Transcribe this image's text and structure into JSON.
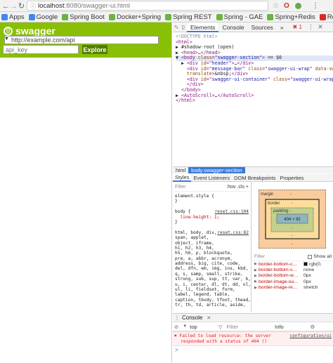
{
  "browser": {
    "url_host": "localhost",
    "url_path": ":8080/swagger-ui.html",
    "menu_icons": [
      "star-icon",
      "opera-icon",
      "extension-icon",
      "menu-icon"
    ],
    "bookmarks": [
      {
        "label": "Apps",
        "color": "#4285f4"
      },
      {
        "label": "Google",
        "color": "#4285f4"
      },
      {
        "label": "Spring Boot",
        "color": "#6db33f"
      },
      {
        "label": "Docker+Spring",
        "color": "#6db33f"
      },
      {
        "label": "Spring REST",
        "color": "#6db33f"
      },
      {
        "label": "Spring - GAE",
        "color": "#6db33f"
      },
      {
        "label": "Spring+Redis",
        "color": "#6db33f"
      },
      {
        "label": "Redis Java",
        "color": "#d82c20"
      }
    ]
  },
  "swagger": {
    "title": "swagger",
    "url_value": "http://example.com/api",
    "api_key_placeholder": "api_key",
    "explore_label": "Explore",
    "brand_color": "#89bf04"
  },
  "devtools": {
    "tabs": [
      "Elements",
      "Console",
      "Sources"
    ],
    "more": "»",
    "error_count": "1",
    "dom_lines": [
      [
        {
          "t": "cmt",
          "v": "<!DOCTYPE html>"
        }
      ],
      [
        {
          "t": "tag",
          "v": "<html>"
        }
      ],
      [
        {
          "t": "txt",
          "v": "▶ #shadow-root (open)"
        }
      ],
      [
        {
          "t": "txt",
          "v": "▶ "
        },
        {
          "t": "tag",
          "v": "<head>"
        },
        {
          "t": "txt",
          "v": "…"
        },
        {
          "t": "tag",
          "v": "</head>"
        }
      ],
      [
        {
          "t": "txt",
          "v": "▼ "
        },
        {
          "t": "tag",
          "v": "<body "
        },
        {
          "t": "attr",
          "v": "class"
        },
        {
          "t": "tag",
          "v": "=\""
        },
        {
          "t": "val",
          "v": "swagger-section"
        },
        {
          "t": "tag",
          "v": "\">"
        },
        {
          "t": "txt",
          "v": " == $0"
        }
      ],
      [
        {
          "t": "txt",
          "v": "  ▶ "
        },
        {
          "t": "tag",
          "v": "<div "
        },
        {
          "t": "attr",
          "v": "id"
        },
        {
          "t": "tag",
          "v": "=\""
        },
        {
          "t": "val",
          "v": "header"
        },
        {
          "t": "tag",
          "v": "\">"
        },
        {
          "t": "txt",
          "v": "…"
        },
        {
          "t": "tag",
          "v": "</div>"
        }
      ],
      [
        {
          "t": "txt",
          "v": "    "
        },
        {
          "t": "tag",
          "v": "<div "
        },
        {
          "t": "attr",
          "v": "id"
        },
        {
          "t": "tag",
          "v": "=\""
        },
        {
          "t": "val",
          "v": "message-bar"
        },
        {
          "t": "tag",
          "v": "\" "
        },
        {
          "t": "attr",
          "v": "class"
        },
        {
          "t": "tag",
          "v": "=\""
        },
        {
          "t": "val",
          "v": "swagger-ui-wrap"
        },
        {
          "t": "tag",
          "v": "\" "
        },
        {
          "t": "attr",
          "v": "data-sw-"
        }
      ],
      [
        {
          "t": "attr",
          "v": "    translate"
        },
        {
          "t": "tag",
          "v": ">"
        },
        {
          "t": "txt",
          "v": "&nbsp;"
        },
        {
          "t": "tag",
          "v": "</div>"
        }
      ],
      [
        {
          "t": "txt",
          "v": "    "
        },
        {
          "t": "tag",
          "v": "<div "
        },
        {
          "t": "attr",
          "v": "id"
        },
        {
          "t": "tag",
          "v": "=\""
        },
        {
          "t": "val",
          "v": "swagger-ui-container"
        },
        {
          "t": "tag",
          "v": "\" "
        },
        {
          "t": "attr",
          "v": "class"
        },
        {
          "t": "tag",
          "v": "=\""
        },
        {
          "t": "val",
          "v": "swagger-ui-wrap"
        },
        {
          "t": "tag",
          "v": "\">"
        }
      ],
      [
        {
          "t": "txt",
          "v": "    "
        },
        {
          "t": "tag",
          "v": "</div>"
        }
      ],
      [
        {
          "t": "txt",
          "v": "  "
        },
        {
          "t": "tag",
          "v": "</body>"
        }
      ],
      [
        {
          "t": "txt",
          "v": "▶ "
        },
        {
          "t": "tag",
          "v": "<AutoScroll>"
        },
        {
          "t": "txt",
          "v": "…"
        },
        {
          "t": "tag",
          "v": "</AutoScroll>"
        }
      ],
      [
        {
          "t": "tag",
          "v": "</html>"
        }
      ]
    ],
    "breadcrumbs": [
      "html",
      "body.swagger-section"
    ],
    "side_tabs": [
      "Styles",
      "Event Listeners",
      "DOM Breakpoints",
      "Properties"
    ],
    "styles": {
      "filter_placeholder": "Filter",
      "filter_tools": ":hov .cls +",
      "lines": [
        "element.style {",
        "}",
        "",
        "body {",
        "  line-height: 1;",
        "}",
        "",
        "html, body, div,",
        "span, applet,",
        "object, iframe,",
        "h1, h2, h3, h4,",
        "h5, h6, p, blockquote,",
        "pre, a, abbr, acronym,",
        "address, big, cite, code,",
        "del, dfn, em, img, ins, kbd,",
        "q, s, samp, small, strike,",
        "strong, sub, sup, tt, var, b,",
        "u, i, center, dl, dt, dd, ol,",
        "ul, li, fieldset, form,",
        "label, legend, table,",
        "caption, tbody, tfoot, thead,",
        "tr, th, td, article, aside,"
      ],
      "sources": [
        "reset.css:104",
        "reset.css:82"
      ]
    },
    "boxmodel": {
      "margin_label": "margin",
      "border_label": "border",
      "padding_label": "padding -",
      "content": "404 × 92",
      "dash": "-"
    },
    "computed": {
      "filter_placeholder": "Filter",
      "show_all": "Show all",
      "rows": [
        {
          "name": "border-bottom-c…",
          "value": "rgb(0,",
          "swatch": true
        },
        {
          "name": "border-bottom-s…",
          "value": "none"
        },
        {
          "name": "border-bottom-w…",
          "value": "0px"
        },
        {
          "name": "border-image-ou…",
          "value": "0px"
        },
        {
          "name": "border-image-re…",
          "value": "stretch"
        }
      ]
    },
    "console": {
      "title": "Console",
      "context": "top",
      "filter_placeholder": "Filter",
      "level": "Info",
      "error_text_1": "Failed to load resource: the server",
      "error_text_2": "responded with a status of 404 ()",
      "error_source": "configuration/ui",
      "prompt": ">"
    }
  }
}
